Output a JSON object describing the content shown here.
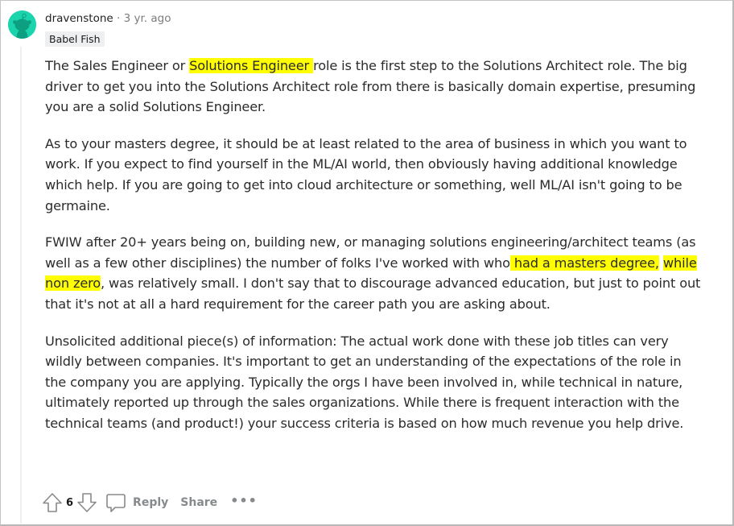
{
  "comment": {
    "author": "dravenstone",
    "separator": "·",
    "time": "3 yr. ago",
    "flair": "Babel Fish",
    "avatar": {
      "icon": "snoo-avatar-icon",
      "color": "#1ad4ad"
    },
    "highlight_color": "#ffff00",
    "paragraphs": [
      [
        {
          "text": "The Sales Engineer or ",
          "highlight": false
        },
        {
          "text": "Solutions Engineer ",
          "highlight": true
        },
        {
          "text": "role is the first step to the Solutions Architect role. The big driver to get you into the Solutions Architect role from there is basically domain expertise, presuming you are a solid Solutions Engineer.",
          "highlight": false
        }
      ],
      [
        {
          "text": "As to your masters degree, it should be at least related to the area of business in which you want to work. If you expect to find yourself in the ML/AI world, then obviously having additional knowledge which help. If you are going to get into cloud architecture or something, well ML/AI isn't going to be germaine.",
          "highlight": false
        }
      ],
      [
        {
          "text": "FWIW after 20+ years being on, building new, or managing solutions engineering/architect teams (as well as a few other disciplines) the number of folks I've worked with who",
          "highlight": false
        },
        {
          "text": " had a masters degree,",
          "highlight": true
        },
        {
          "text": " ",
          "highlight": false
        },
        {
          "text": "while non zero",
          "highlight": true
        },
        {
          "text": ", was relatively small. I don't say that to discourage advanced education, but just to point out that it's not at all a hard requirement for the career path you are asking about.",
          "highlight": false
        }
      ],
      [
        {
          "text": "Unsolicited additional piece(s) of information: The actual work done with these job titles can very wildly between companies. It's important to get an understanding of the expectations of the role in the company you are applying. Typically the orgs I have been involved in, while technical in nature, ultimately reported up through the sales organizations. While there is frequent interaction with the technical teams (and product!) your success criteria is based on how much revenue you help drive.",
          "highlight": false
        }
      ]
    ]
  },
  "actions": {
    "upvote_icon": "upvote-arrow-icon",
    "vote_count": "6",
    "downvote_icon": "downvote-arrow-icon",
    "reply_icon": "comment-bubble-icon",
    "reply_label": "Reply",
    "share_label": "Share",
    "more_label": "•••"
  }
}
